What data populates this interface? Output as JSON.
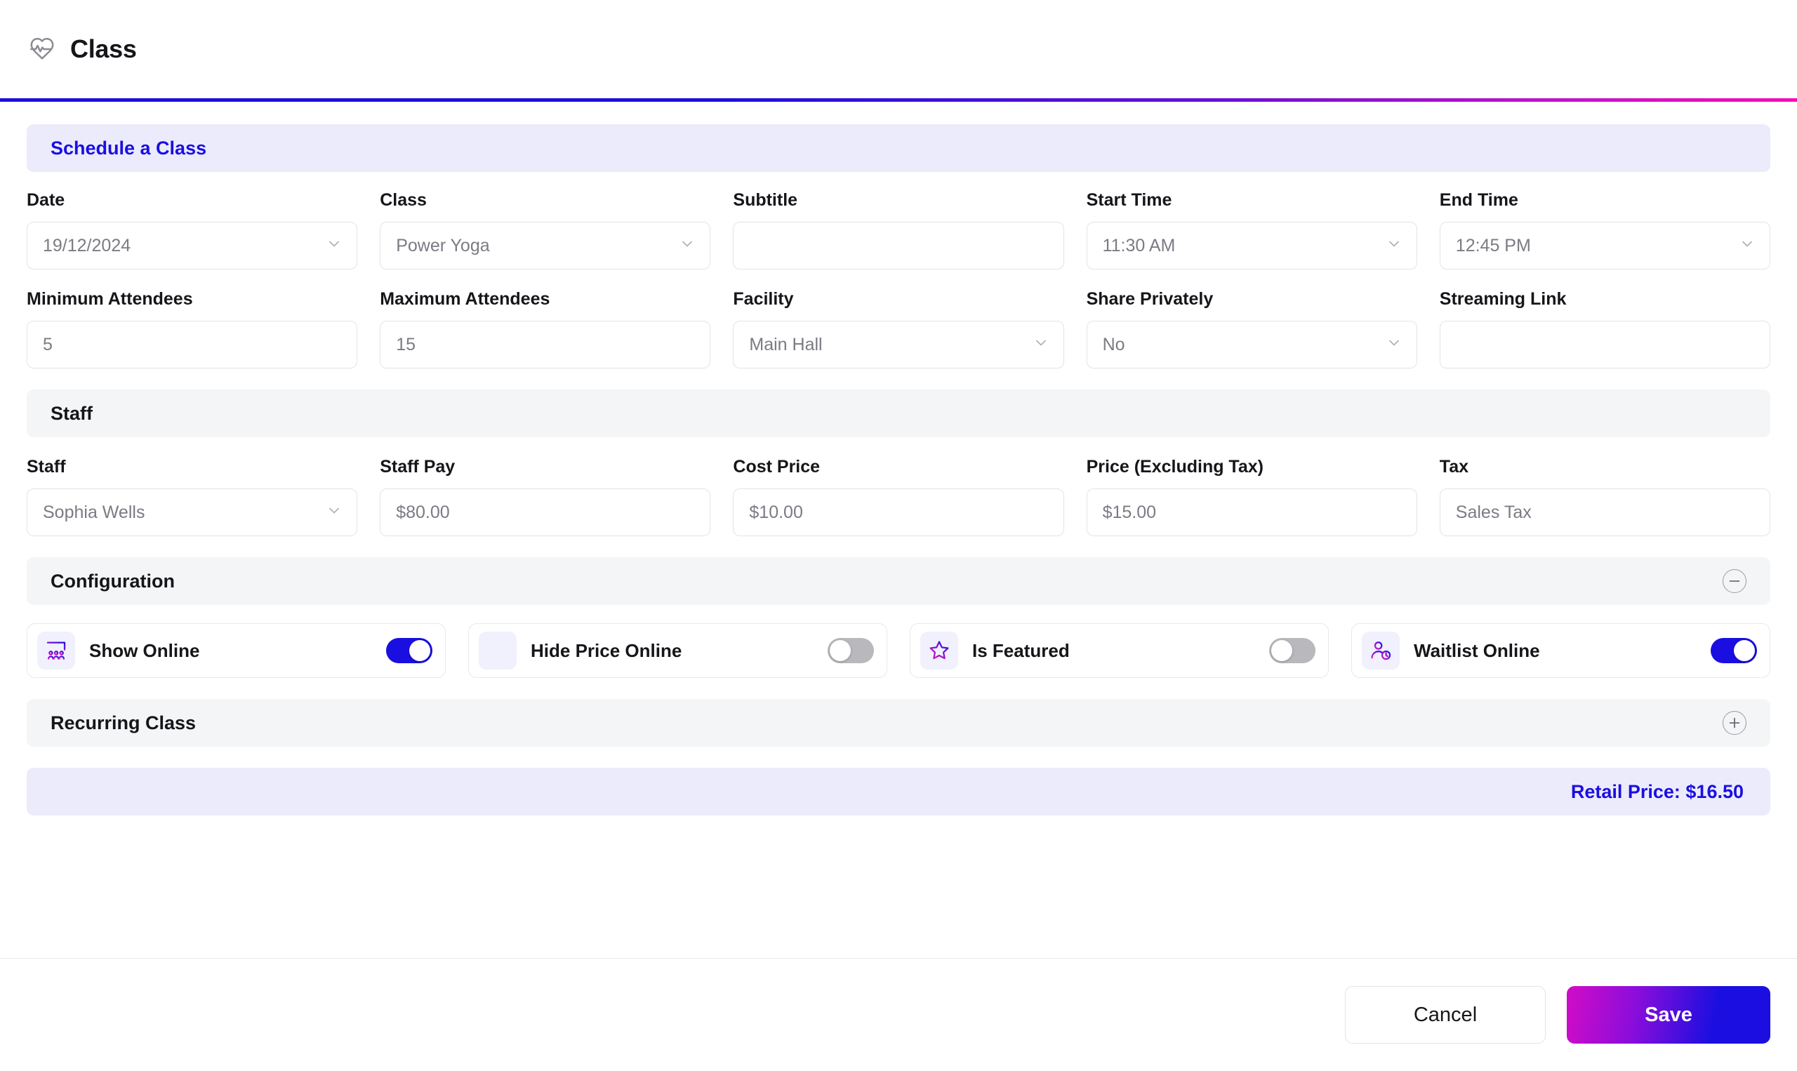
{
  "window": {
    "title": "Class",
    "icon": "heart-pulse-icon"
  },
  "colors": {
    "accent_blue": "#1a0fe0",
    "accent_magenta": "#f50cb8",
    "section_accent_bg": "#ecebfc",
    "section_plain_bg": "#f4f5f7",
    "toggle_on": "#1a0fe0",
    "toggle_off": "#b8b8bd"
  },
  "schedule": {
    "section_title": "Schedule a Class",
    "fields": [
      {
        "label": "Date",
        "value": "19/12/2024",
        "type": "select",
        "placeholder": ""
      },
      {
        "label": "Class",
        "value": "Power Yoga",
        "type": "select",
        "placeholder": ""
      },
      {
        "label": "Subtitle",
        "value": "",
        "type": "text",
        "placeholder": ""
      },
      {
        "label": "Start Time",
        "value": "11:30 AM",
        "type": "select",
        "placeholder": ""
      },
      {
        "label": "End Time",
        "value": "12:45 PM",
        "type": "select",
        "placeholder": ""
      },
      {
        "label": "Minimum Attendees",
        "value": "5",
        "type": "text",
        "placeholder": ""
      },
      {
        "label": "Maximum Attendees",
        "value": "15",
        "type": "text",
        "placeholder": ""
      },
      {
        "label": "Facility",
        "value": "Main Hall",
        "type": "select",
        "placeholder": ""
      },
      {
        "label": "Share Privately",
        "value": "No",
        "type": "select",
        "placeholder": ""
      },
      {
        "label": "Streaming Link",
        "value": "",
        "type": "text",
        "placeholder": ""
      }
    ]
  },
  "staff": {
    "section_title": "Staff",
    "fields": [
      {
        "label": "Staff",
        "value": "Sophia Wells",
        "type": "select"
      },
      {
        "label": "Staff Pay",
        "value": "$80.00",
        "type": "text"
      },
      {
        "label": "Cost Price",
        "value": "$10.00",
        "type": "text"
      },
      {
        "label": "Price (Excluding Tax)",
        "value": "$15.00",
        "type": "text"
      },
      {
        "label": "Tax",
        "value": "Sales Tax",
        "type": "text"
      }
    ]
  },
  "configuration": {
    "section_title": "Configuration",
    "collapse_icon": "minus-circle-icon",
    "toggles": [
      {
        "label": "Show Online",
        "icon": "group-people-icon",
        "on": true
      },
      {
        "label": "Hide Price Online",
        "icon": "barcode-icon",
        "on": false
      },
      {
        "label": "Is Featured",
        "icon": "star-icon",
        "on": false
      },
      {
        "label": "Waitlist Online",
        "icon": "person-clock-icon",
        "on": true
      }
    ]
  },
  "recurring": {
    "section_title": "Recurring Class",
    "expand_icon": "plus-circle-icon"
  },
  "summary": {
    "retail_price_text": "Retail Price: $16.50"
  },
  "footer": {
    "cancel_label": "Cancel",
    "save_label": "Save"
  }
}
